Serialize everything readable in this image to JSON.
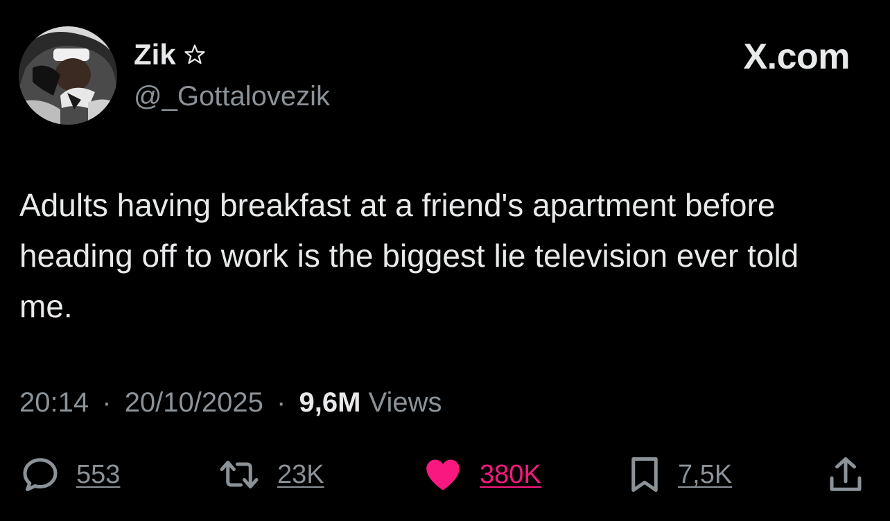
{
  "author": {
    "display_name": "Zik",
    "handle": "@_Gottalovezik",
    "badge_icon": "star-outline-icon"
  },
  "brand": {
    "label": "X.com"
  },
  "tweet": {
    "text": "Adults having breakfast at a friend's apartment before heading off to work is the biggest lie television ever told me."
  },
  "meta": {
    "time": "20:14",
    "separator": "·",
    "date": "20/10/2025",
    "views_count": "9,6M",
    "views_label": "Views"
  },
  "actions": {
    "replies": {
      "icon": "reply-icon",
      "count": "553"
    },
    "reposts": {
      "icon": "repost-icon",
      "count": "23K"
    },
    "likes": {
      "icon": "heart-filled-icon",
      "count": "380K",
      "active": true
    },
    "bookmarks": {
      "icon": "bookmark-icon",
      "count": "7,5K"
    },
    "share": {
      "icon": "share-icon"
    }
  },
  "colors": {
    "background": "#000000",
    "primary_text": "#e7e9ea",
    "secondary_text": "#8b9298",
    "like_active": "#f91880"
  }
}
